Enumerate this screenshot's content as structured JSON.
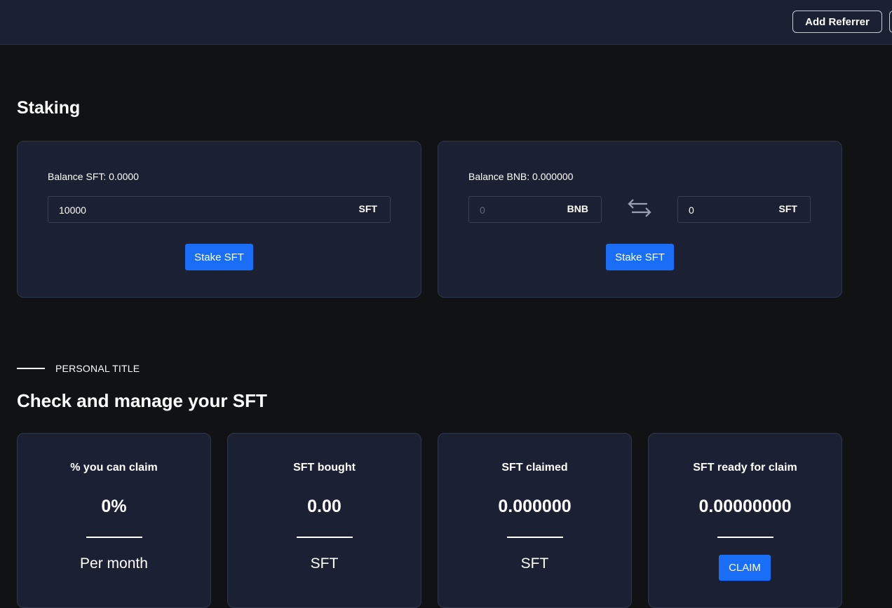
{
  "header": {
    "add_referrer_label": "Add Referrer",
    "second_button_label": ""
  },
  "staking": {
    "title": "Staking",
    "sft_card": {
      "balance_text": "Balance SFT: 0.0000",
      "input_value": "10000",
      "unit": "SFT",
      "button_label": "Stake SFT"
    },
    "bnb_card": {
      "balance_text": "Balance BNB: 0.000000",
      "bnb_placeholder": "0",
      "bnb_unit": "BNB",
      "sft_value": "0",
      "sft_unit": "SFT",
      "swap_icon": "swap-arrows-icon",
      "button_label": "Stake SFT"
    }
  },
  "personal": {
    "eyebrow": "PERSONAL TITLE",
    "title": "Check and manage your SFT",
    "stats": [
      {
        "label": "% you can claim",
        "value": "0%",
        "sub": "Per month"
      },
      {
        "label": "SFT bought",
        "value": "0.00",
        "sub": "SFT"
      },
      {
        "label": "SFT claimed",
        "value": "0.000000",
        "sub": "SFT"
      },
      {
        "label": "SFT ready for claim",
        "value": "0.00000000",
        "button_label": "CLAIM"
      }
    ]
  },
  "colors": {
    "accent": "#1a6ef5",
    "card_bg": "#1b2133",
    "page_bg": "#111214"
  }
}
